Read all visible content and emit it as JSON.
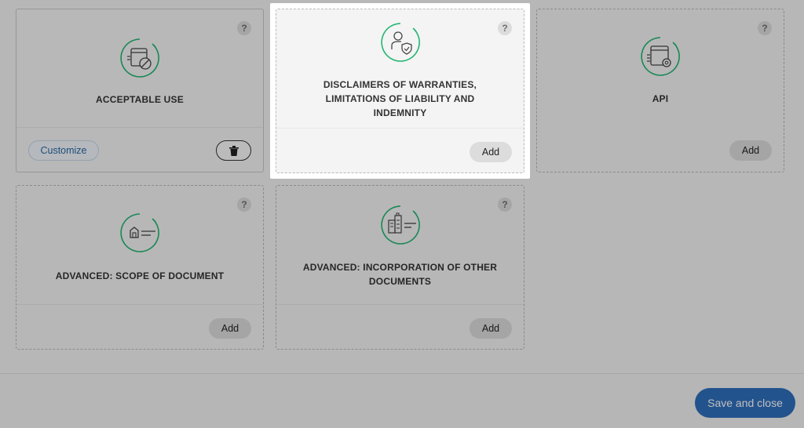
{
  "cards": [
    {
      "title": "Acceptable Use",
      "state": "added",
      "customize_label": "Customize",
      "help": "?"
    },
    {
      "title": "Disclaimers of Warranties, Limitations of Liability and Indemnity",
      "state": "available",
      "add_label": "Add",
      "help": "?"
    },
    {
      "title": "API",
      "state": "available",
      "add_label": "Add",
      "help": "?"
    },
    {
      "title": "Advanced: Scope of Document",
      "state": "available",
      "add_label": "Add",
      "help": "?"
    },
    {
      "title": "Advanced: Incorporation of Other Documents",
      "state": "available",
      "add_label": "Add",
      "help": "?"
    }
  ],
  "footer": {
    "save_close_label": "Save and close"
  },
  "colors": {
    "accent_green": "#22b573",
    "primary_blue": "#2f6fbd",
    "link_blue": "#2a6aa6"
  }
}
